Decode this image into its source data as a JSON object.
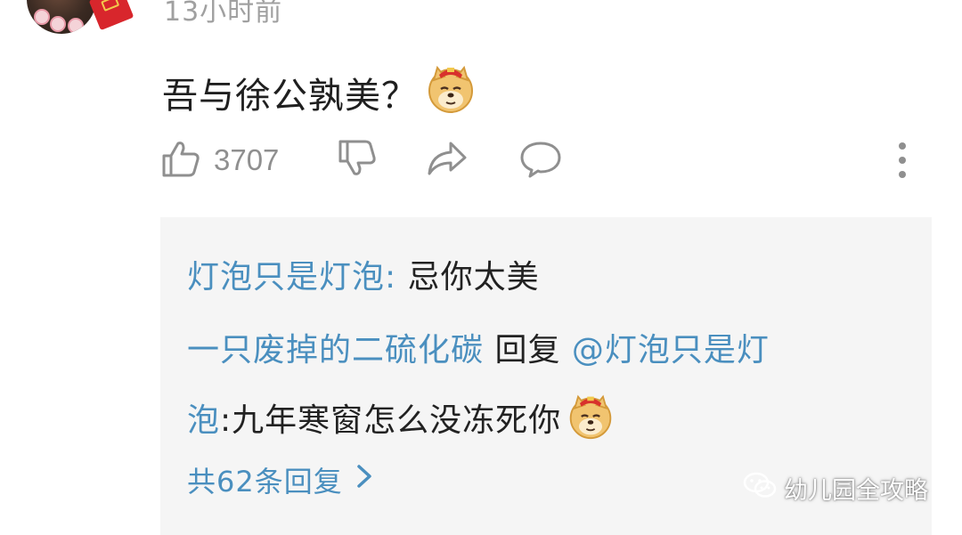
{
  "comment": {
    "timestamp": "13小时前",
    "text": "吾与徐公孰美？",
    "emoji": "doge-emoji",
    "like_count": "3707"
  },
  "actions": {
    "icons": [
      "thumbs-up-icon",
      "thumbs-down-icon",
      "share-icon",
      "comment-icon",
      "more-icon"
    ]
  },
  "replies": {
    "items": [
      {
        "user": "灯泡只是灯泡",
        "separator": ": ",
        "text": "忌你太美"
      },
      {
        "user": "一只废掉的二硫化碳",
        "reply_word": " 回复 ",
        "mention_part1": "@灯泡只是灯",
        "mention_part2": "泡",
        "text": " :九年寒窗怎么没冻死你",
        "emoji": "doge-emoji"
      }
    ],
    "more_label": "共62条回复"
  },
  "watermark": {
    "label": "幼儿园全攻略"
  },
  "colors": {
    "link": "#4a8fbf",
    "text": "#222222",
    "muted": "#8f8f8f",
    "reply_bg": "#f5f5f5"
  }
}
